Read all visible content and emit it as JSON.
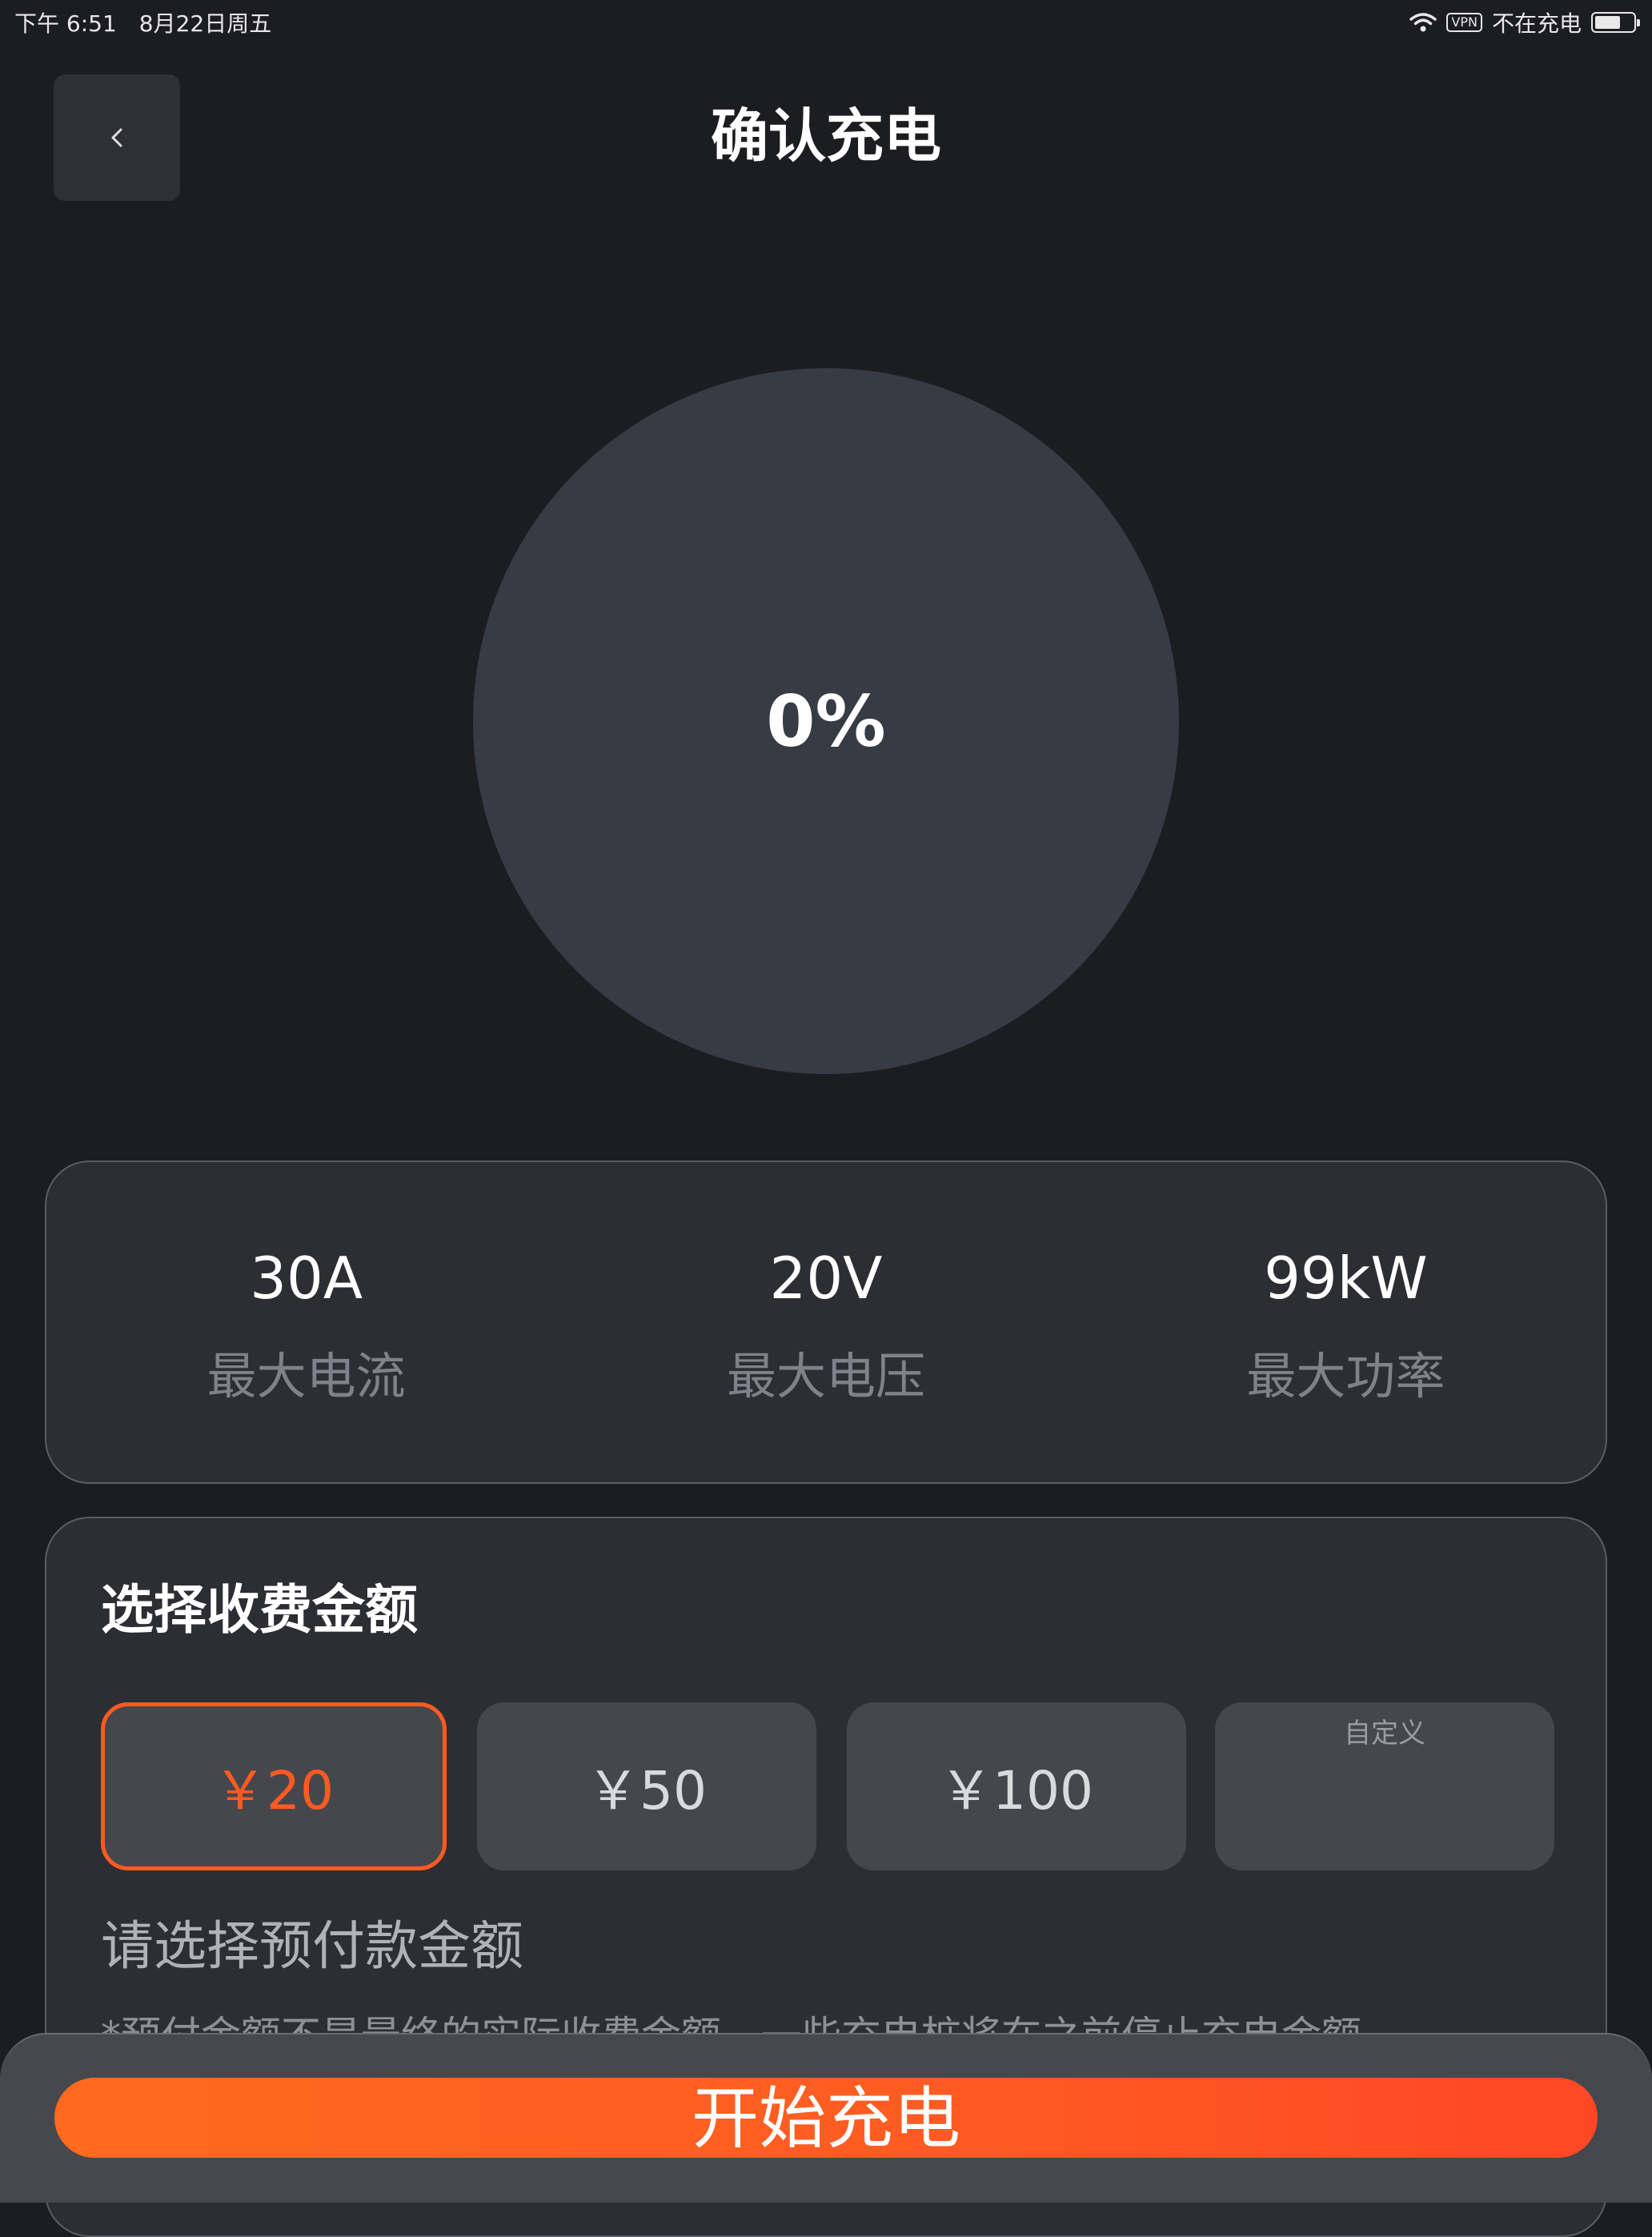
{
  "status_bar": {
    "time": "下午 6:51",
    "date": "8月22日周五",
    "vpn": "VPN",
    "charging_status": "不在充电",
    "battery_level_percent": 70
  },
  "header": {
    "back_icon": "chevron-left-icon",
    "title": "确认充电"
  },
  "progress": {
    "value": "0%"
  },
  "specs": [
    {
      "value": "30A",
      "label": "最大电流"
    },
    {
      "value": "20V",
      "label": "最大电压"
    },
    {
      "value": "99kW",
      "label": "最大功率"
    }
  ],
  "amount": {
    "title": "选择收费金额",
    "options": [
      {
        "label": "￥20",
        "selected": true
      },
      {
        "label": "￥50",
        "selected": false
      },
      {
        "label": "￥100",
        "selected": false
      }
    ],
    "custom_placeholder": "自定义",
    "custom_value": "",
    "hint": "请选择预付款金额",
    "note": "*预付金额不是最终的实际收费金额，一些充电桩将在之前停止充电金额"
  },
  "actions": {
    "start_label": "开始充电"
  },
  "colors": {
    "background": "#1c1d21",
    "accent": "#ff5a21",
    "card": "#2c2e33"
  }
}
